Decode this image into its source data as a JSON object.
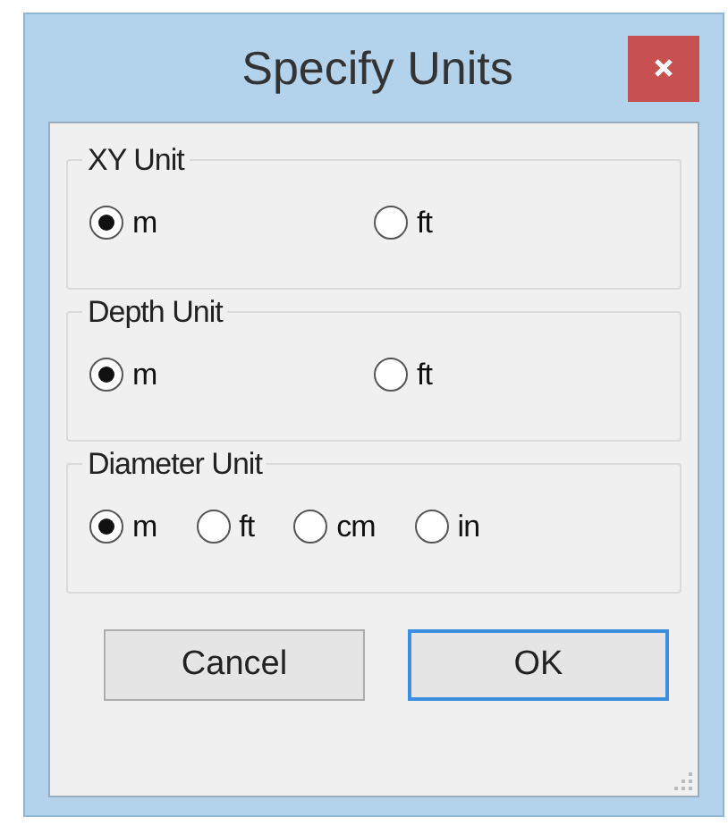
{
  "window": {
    "title": "Specify Units"
  },
  "groups": [
    {
      "label": "XY Unit",
      "options": [
        {
          "label": "m",
          "selected": true
        },
        {
          "label": "ft",
          "selected": false
        }
      ]
    },
    {
      "label": "Depth Unit",
      "options": [
        {
          "label": "m",
          "selected": true
        },
        {
          "label": "ft",
          "selected": false
        }
      ]
    },
    {
      "label": "Diameter Unit",
      "options": [
        {
          "label": "m",
          "selected": true
        },
        {
          "label": "ft",
          "selected": false
        },
        {
          "label": "cm",
          "selected": false
        },
        {
          "label": "in",
          "selected": false
        }
      ]
    }
  ],
  "buttons": [
    {
      "label": "Cancel",
      "default": false
    },
    {
      "label": "OK",
      "default": true
    }
  ]
}
